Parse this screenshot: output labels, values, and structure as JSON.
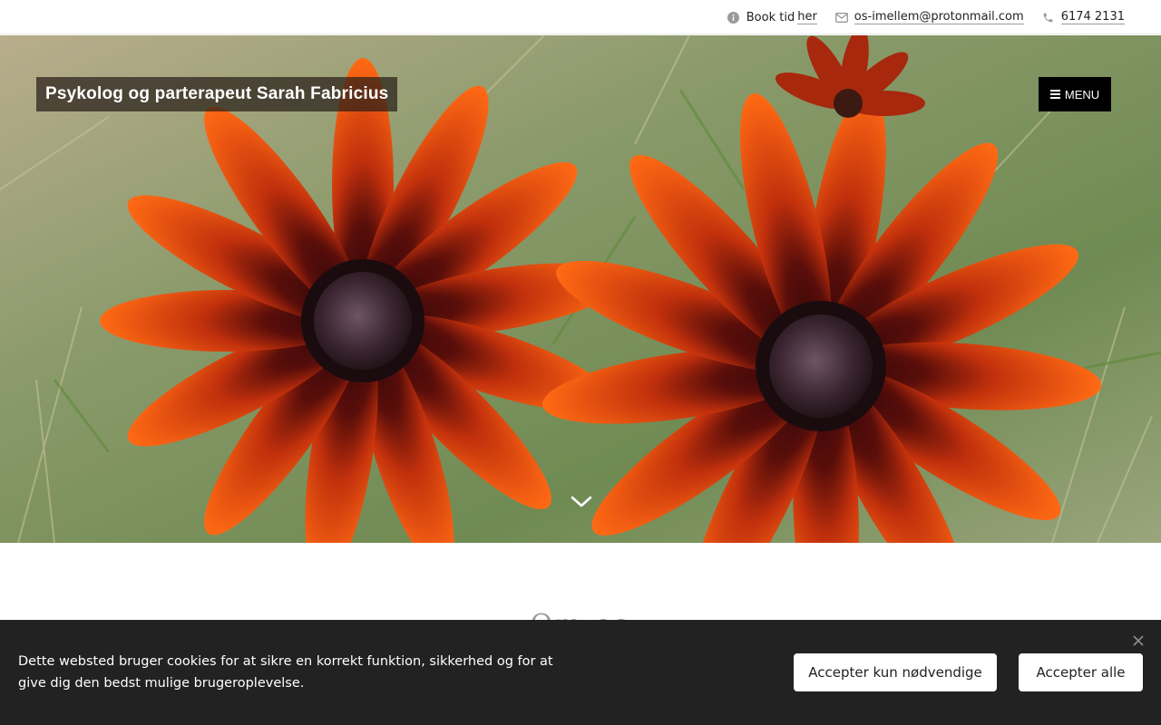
{
  "topbar": {
    "booking": {
      "icon": "info-icon",
      "prefix": "Book tid",
      "link": "her"
    },
    "email": {
      "icon": "mail-icon",
      "address": "os-imellem@protonmail.com"
    },
    "phone": {
      "icon": "phone-icon",
      "number": "6174 2131"
    }
  },
  "header": {
    "site_title": "Psykolog og parterapeut Sarah Fabricius",
    "menu_label": "MENU",
    "menu_icon": "hamburger-icon",
    "scroll_icon": "chevron-down-icon"
  },
  "hero": {
    "image": "orange-rudbeckia-flowers-photo"
  },
  "content": {
    "heading": "Om os"
  },
  "cookie_banner": {
    "message": "Dette websted bruger cookies for at sikre en korrekt funktion, sikkerhed og for at give dig den bedst mulige brugeroplevelse.",
    "accept_necessary": "Accepter kun nødvendige",
    "accept_all": "Accepter alle",
    "close_icon": "close-icon"
  },
  "colors": {
    "cookie_background": "#222222",
    "menu_background": "#000000",
    "logo_background": "#281e19"
  }
}
